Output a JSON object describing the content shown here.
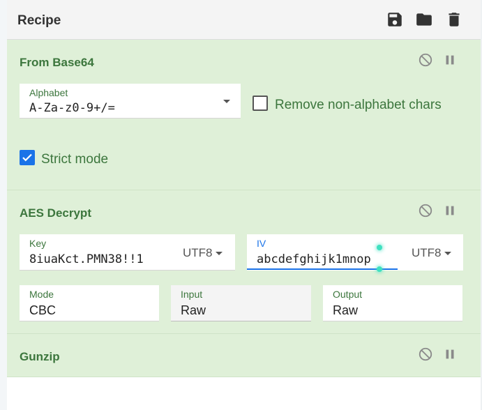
{
  "header": {
    "title": "Recipe",
    "icons": [
      "save-icon",
      "folder-icon",
      "trash-icon"
    ]
  },
  "operations": {
    "from_base64": {
      "title": "From Base64",
      "alphabet_label": "Alphabet",
      "alphabet_value": "A-Za-z0-9+/=",
      "remove_nonalpha_label": "Remove non-alphabet chars",
      "remove_nonalpha_checked": false,
      "strict_label": "Strict mode",
      "strict_checked": true
    },
    "aes_decrypt": {
      "title": "AES Decrypt",
      "key_label": "Key",
      "key_value": "8iuaKct.PMN38!!1",
      "key_encoding": "UTF8",
      "iv_label": "IV",
      "iv_value": "abcdefghijk1mnop",
      "iv_encoding": "UTF8",
      "mode_label": "Mode",
      "mode_value": "CBC",
      "input_label": "Input",
      "input_value": "Raw",
      "output_label": "Output",
      "output_value": "Raw"
    },
    "gunzip": {
      "title": "Gunzip"
    }
  },
  "colors": {
    "op_background": "#dff0d8",
    "op_title": "#3c763d",
    "accent_blue": "#1a73e8"
  }
}
